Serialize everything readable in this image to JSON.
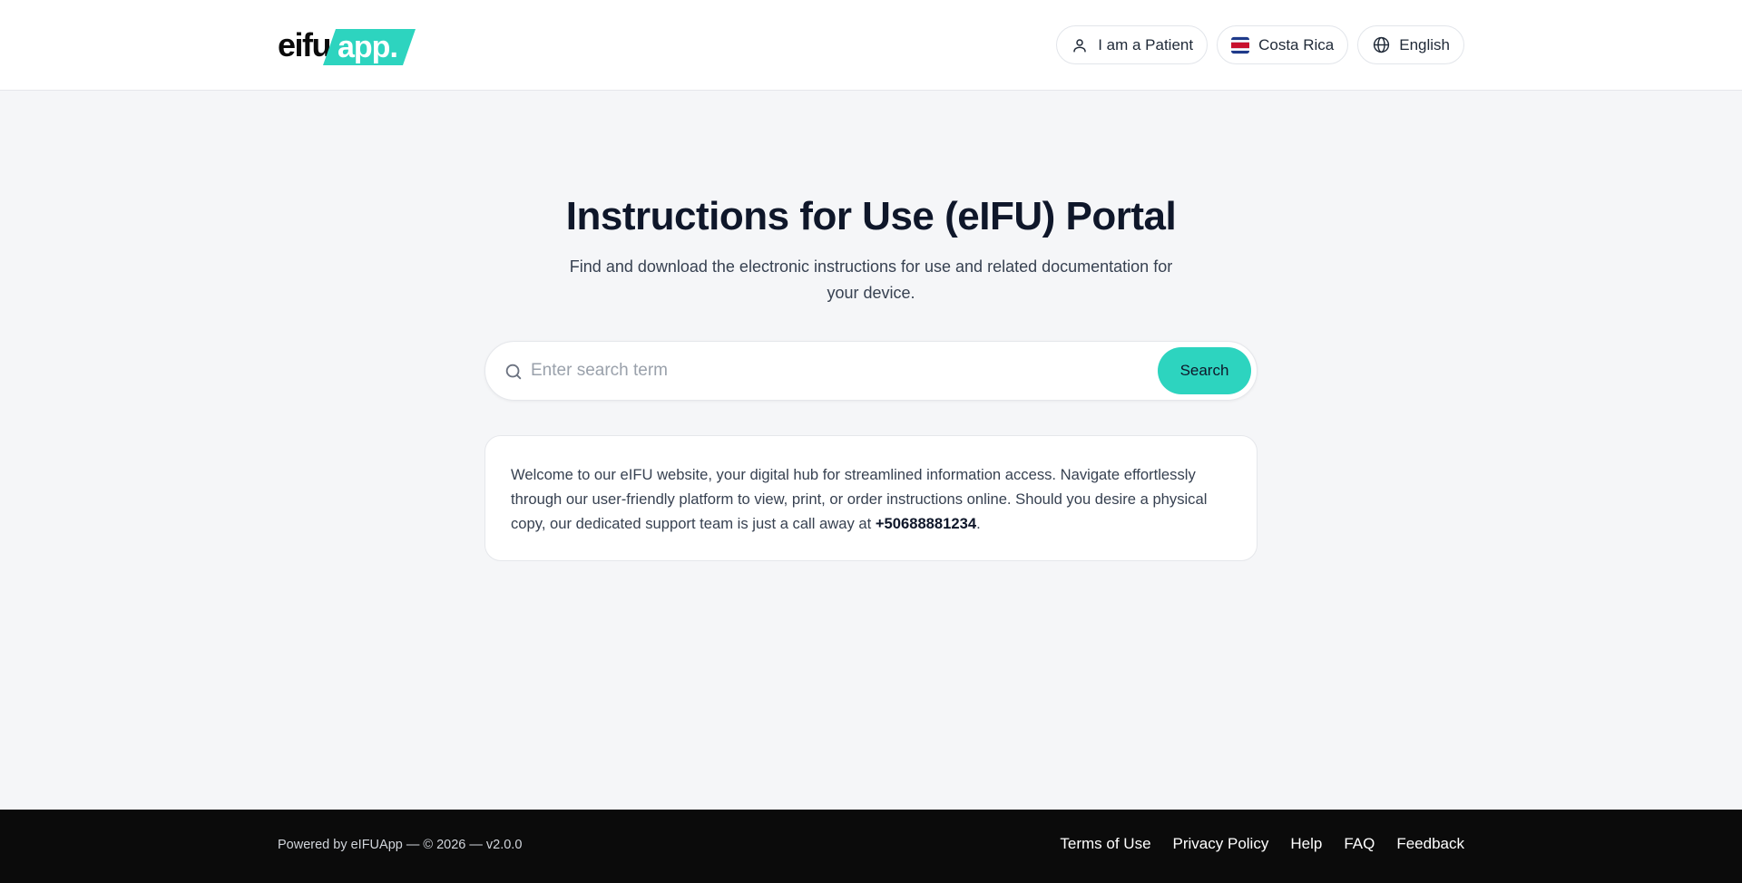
{
  "header": {
    "logo_text": "eifu",
    "logo_badge_text": "app.",
    "brand_color": "#2dd4bf",
    "pills": [
      {
        "label": "I am a Patient",
        "icon": "user-icon"
      },
      {
        "label": "Costa Rica",
        "icon": "costa-rica-flag-icon"
      },
      {
        "label": "English",
        "icon": "globe-icon"
      }
    ]
  },
  "hero": {
    "title": "Instructions for Use (eIFU) Portal",
    "subtitle": "Find and download the electronic instructions for use and related documentation for your device."
  },
  "search": {
    "placeholder": "Enter search term",
    "value": "",
    "button_label": "Search",
    "icon": "search-icon"
  },
  "welcome": {
    "text_before": "Welcome to our eIFU website, your digital hub for streamlined information access. Navigate effortlessly through our user-friendly platform to view, print, or order instructions online. Should you desire a physical copy, our dedicated support team is just a call away at ",
    "phone": "+50688881234",
    "text_after": "."
  },
  "footer": {
    "powered_by": "Powered by eIFUApp — © 2026 — v2.0.0",
    "links": [
      "Terms of Use",
      "Privacy Policy",
      "Help",
      "FAQ",
      "Feedback"
    ]
  }
}
